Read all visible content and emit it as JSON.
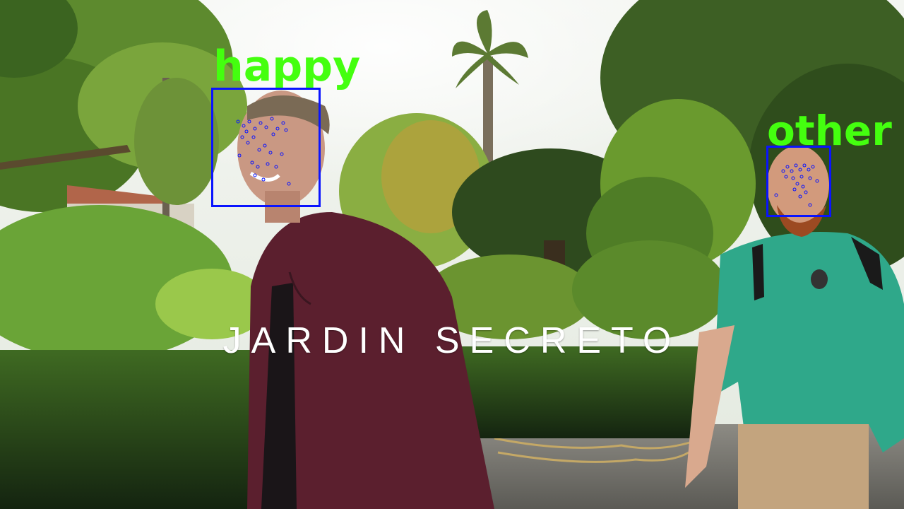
{
  "caption": "JARDIN SECRETO",
  "colors": {
    "box": "#0a14ff",
    "label": "#44ff0f",
    "caption": "#ffffff"
  },
  "detections": [
    {
      "label": "happy"
    },
    {
      "label": "other"
    }
  ]
}
